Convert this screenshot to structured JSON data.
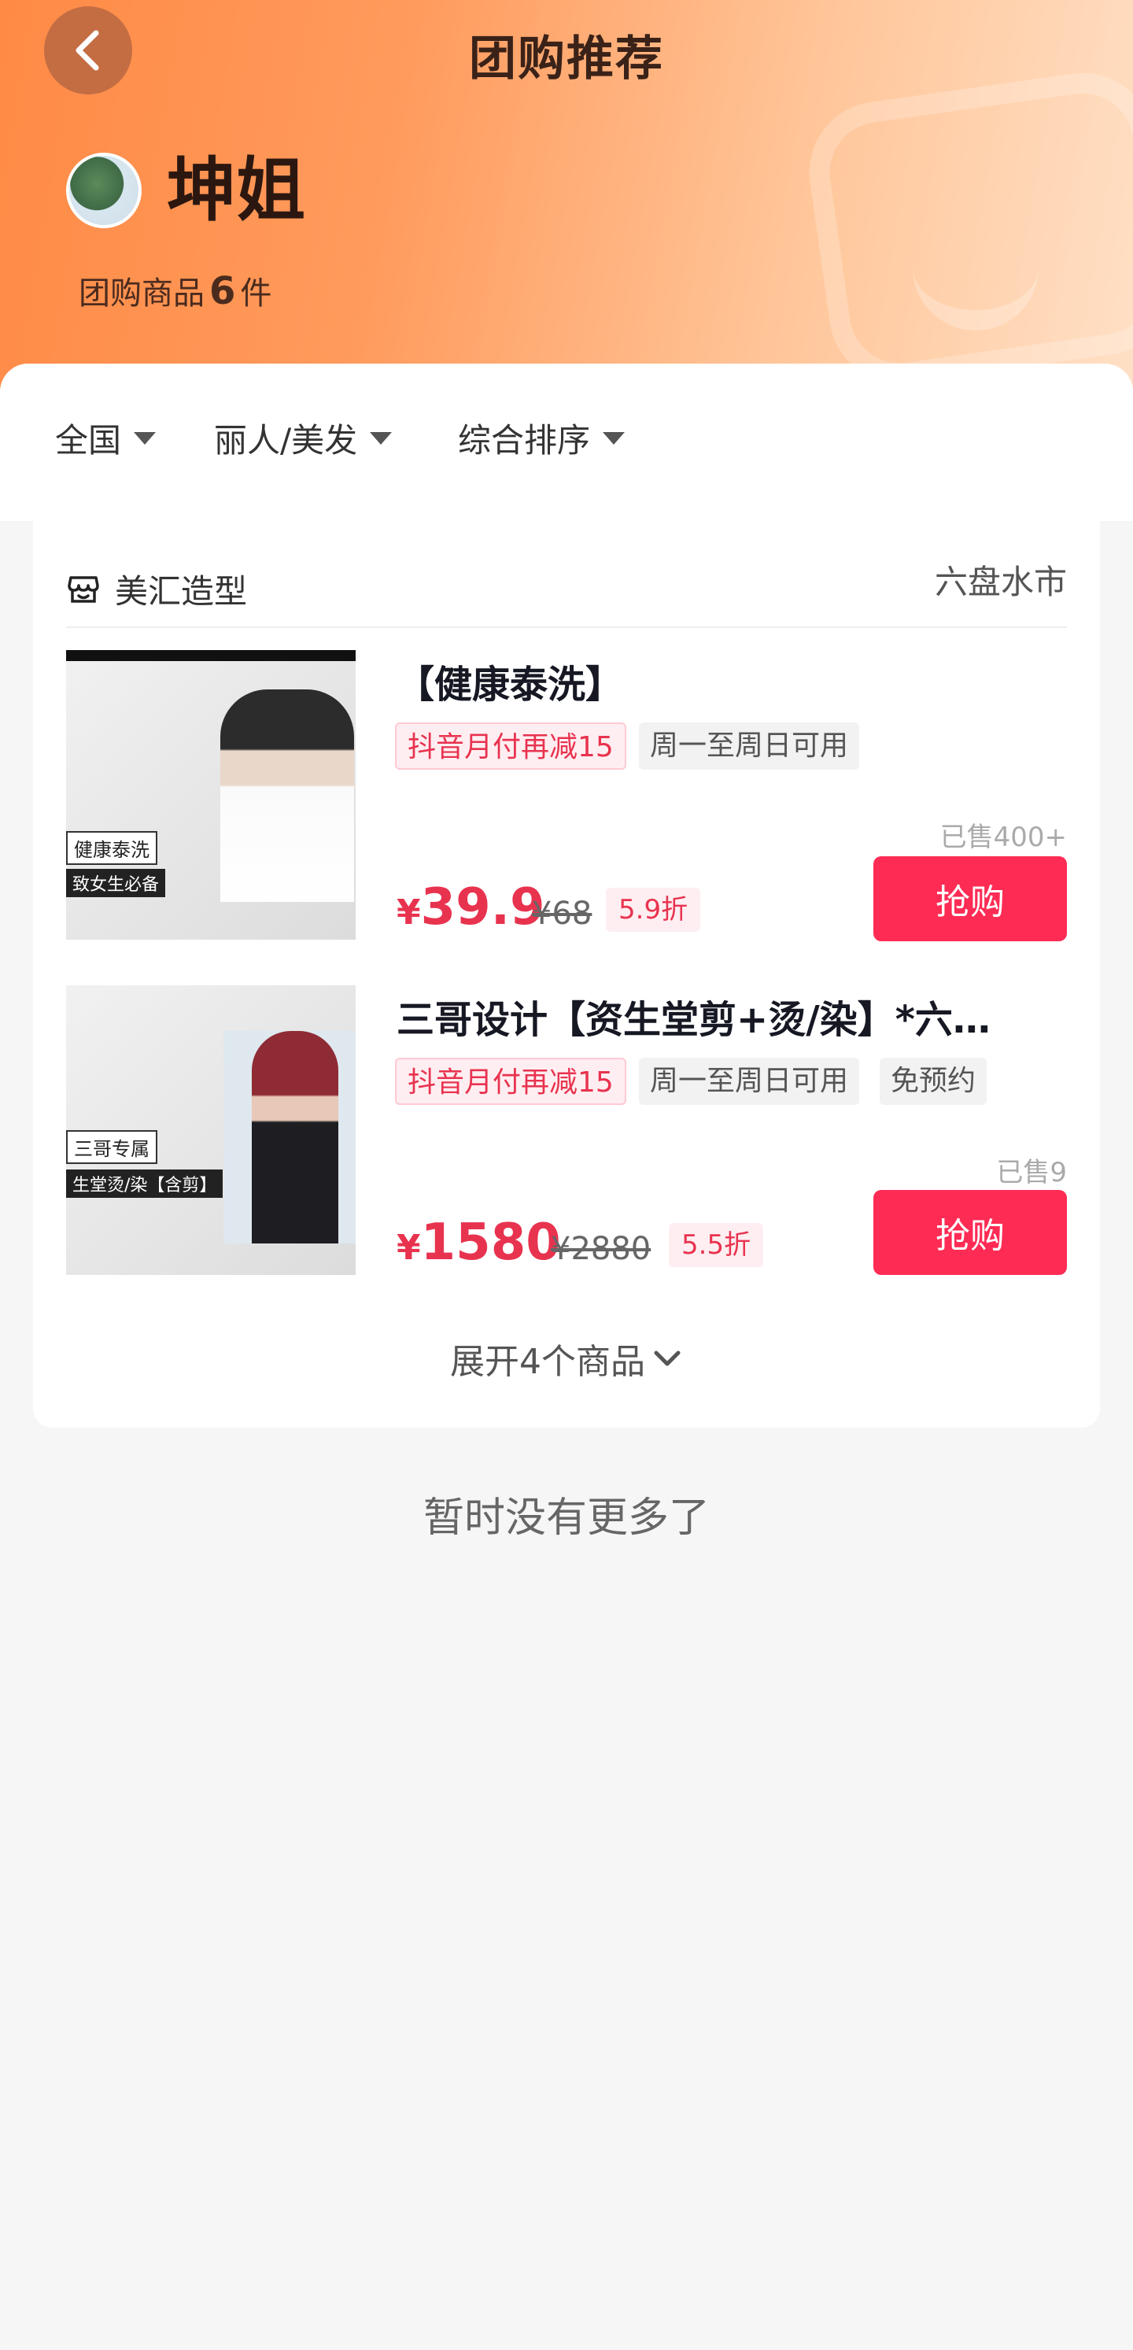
{
  "header": {
    "title": "团购推荐",
    "store_name": "坤姐",
    "goods_count_prefix": "团购商品",
    "goods_count": "6",
    "goods_count_suffix": "件"
  },
  "filters": [
    "全国",
    "丽人/美发",
    "综合排序"
  ],
  "shop": {
    "name": "美汇造型",
    "city": "六盘水市"
  },
  "products": [
    {
      "title": "【健康泰洗】",
      "tags": [
        "抖音月付再减15",
        "周一至周日可用"
      ],
      "thumb_caption_1": "健康泰洗",
      "thumb_caption_2": "致女生必备",
      "sold": "已售400+",
      "price_symbol": "¥",
      "price": "39.9",
      "original_price": "¥68",
      "discount": "5.9折",
      "buy_label": "抢购"
    },
    {
      "title": "三哥设计【资生堂剪+烫/染】*六…",
      "tags": [
        "抖音月付再减15",
        "周一至周日可用",
        "免预约"
      ],
      "thumb_caption_1": "三哥专属",
      "thumb_caption_2": "生堂烫/染【含剪】",
      "sold": "已售9",
      "price_symbol": "¥",
      "price": "1580",
      "original_price": "¥2880",
      "discount": "5.5折",
      "buy_label": "抢购"
    }
  ],
  "expand_label": "展开4个商品",
  "no_more_label": "暂时没有更多了",
  "colors": {
    "accent": "#fe2c55",
    "price": "#e8334f",
    "header_start": "#ff8a45",
    "header_end": "#ffe0c6"
  }
}
